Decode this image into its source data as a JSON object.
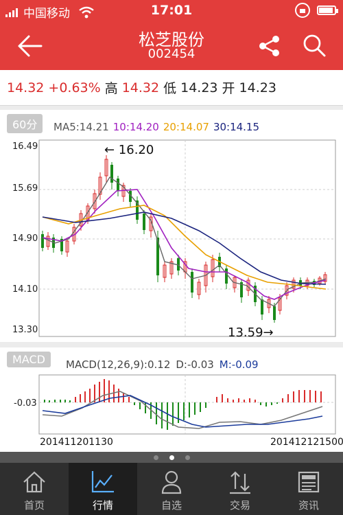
{
  "status": {
    "carrier": "中国移动",
    "time": "17:01"
  },
  "header": {
    "title": "松芝股份",
    "code": "002454"
  },
  "quote": {
    "price": "14.32",
    "change": "+0.63%",
    "high_label": "高",
    "high": "14.32",
    "low_label": "低",
    "low": "14.23",
    "open_label": "开",
    "open": "14.23"
  },
  "kline": {
    "period": "60分",
    "ma5": "MA5:14.21",
    "ma10": "10:14.20",
    "ma20": "20:14.07",
    "ma30": "30:14.15",
    "max_label": "← 16.20",
    "min_label": "13.59→",
    "colors": {
      "ma5": "#cc7a00",
      "ma10": "#a020c0",
      "ma20": "#e8a000",
      "ma30": "#1a237e",
      "up": "#d92b2b",
      "down": "#1a8a1a"
    }
  },
  "macd": {
    "tag": "MACD",
    "params": "MACD(12,26,9):0.12",
    "d": "D:-0.03",
    "m": "M:-0.09",
    "axis": "-0.03",
    "start": "201411201130",
    "end": "201412121500"
  },
  "chart_data": {
    "type": "candlestick",
    "y_ticks": [
      "16.49",
      "15.69",
      "14.90",
      "14.10",
      "13.30"
    ],
    "ylim": [
      13.3,
      16.49
    ],
    "high": 16.2,
    "low": 13.59
  },
  "tabs": [
    {
      "label": "首页",
      "icon": "home-icon"
    },
    {
      "label": "行情",
      "icon": "chart-icon"
    },
    {
      "label": "自选",
      "icon": "user-icon"
    },
    {
      "label": "交易",
      "icon": "trade-icon"
    },
    {
      "label": "资讯",
      "icon": "news-icon"
    }
  ]
}
